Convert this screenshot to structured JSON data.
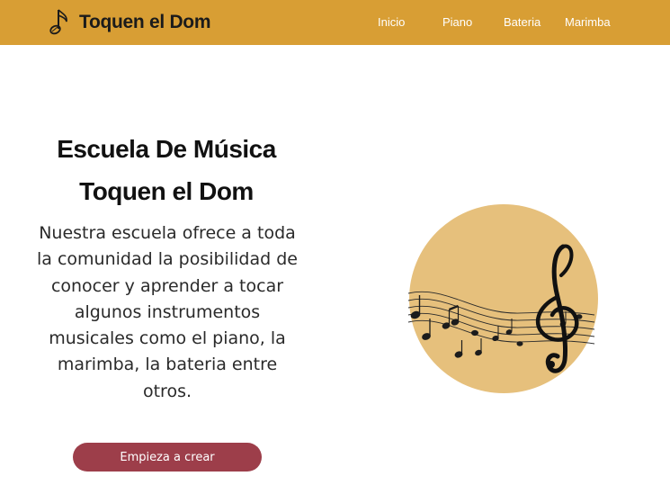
{
  "header": {
    "brand_name": "Toquen el Dom",
    "brand_icon": "music-note-icon",
    "nav": [
      {
        "label": "Inicio"
      },
      {
        "label": "Piano"
      },
      {
        "label": "Bateria"
      },
      {
        "label": "Marimba"
      }
    ]
  },
  "hero": {
    "title_line1": "Escuela De Música",
    "title_line2": "Toquen el Dom",
    "description": "Nuestra escuela ofrece a toda la comunidad la posibilidad de conocer y aprender a tocar algunos instrumentos musicales como el piano, la marimba, la bateria entre otros.",
    "cta_label": "Empieza a crear"
  },
  "illustration": {
    "icon": "treble-clef-staff-icon"
  },
  "colors": {
    "header_bg": "#d89e34",
    "cta_bg": "#9d3e4a",
    "circle_bg": "#e6c07c"
  }
}
